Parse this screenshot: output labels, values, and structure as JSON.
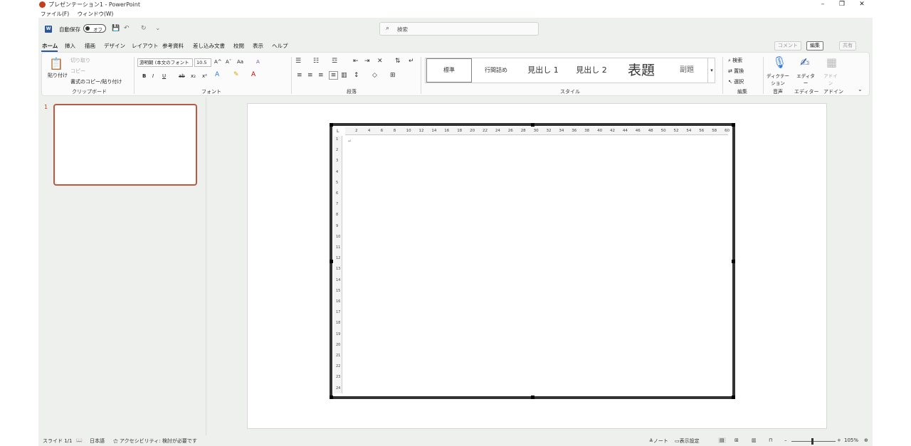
{
  "title_bar": {
    "title": "プレゼンテーション1 - PowerPoint",
    "minimize": "–",
    "restore": "❐",
    "close": "✕"
  },
  "menu_bar": [
    "ファイル(F)",
    "ウィンドウ(W)"
  ],
  "quick_access": {
    "app_letter": "W",
    "autosave_label": "自動保存",
    "autosave_state": "オフ",
    "save_icon": "💾",
    "undo_icon": "↶",
    "redo_icon": "↻",
    "more_icon": "⌄"
  },
  "search": {
    "icon": "⌕",
    "placeholder": "検索"
  },
  "tabs": [
    "ホーム",
    "挿入",
    "描画",
    "デザイン",
    "レイアウト",
    "参考資料",
    "差し込み文書",
    "校閲",
    "表示",
    "ヘルプ"
  ],
  "right_tabs": {
    "comments": "コメント",
    "editing": "編集",
    "share": "共有"
  },
  "ribbon": {
    "clipboard": {
      "paste": "貼り付け",
      "cut": "切り取り",
      "copy": "コピー",
      "format_painter": "書式のコピー/貼り付け",
      "label": "クリップボード"
    },
    "font": {
      "font_name": "游明朝 (本文のフォント",
      "font_size": "10.5",
      "grow": "A^",
      "shrink": "Aˇ",
      "case": "Aa",
      "clear": "A",
      "bold": "B",
      "italic": "I",
      "underline": "U",
      "strike": "ab",
      "sub": "x₂",
      "sup": "x²",
      "label": "フォント"
    },
    "paragraph": {
      "label": "段落"
    },
    "styles": {
      "items": [
        "標準",
        "行間詰め",
        "見出し 1",
        "見出し 2",
        "表題",
        "副題"
      ],
      "label": "スタイル"
    },
    "editing": {
      "find": "検索",
      "replace": "置換",
      "select": "選択",
      "label": "編集"
    },
    "voice": {
      "dictate": "ディクテーション",
      "label": "音声"
    },
    "editor": {
      "name": "エディター",
      "label": "エディター"
    },
    "addins": {
      "name": "アドイン",
      "label": "アドイン"
    }
  },
  "thumbnail": {
    "number": "1"
  },
  "ruler": {
    "h_ticks": [
      "2",
      "4",
      "6",
      "8",
      "10",
      "12",
      "14",
      "16",
      "18",
      "20",
      "22",
      "24",
      "26",
      "28",
      "30",
      "32",
      "34",
      "36",
      "38",
      "40",
      "42",
      "44",
      "46",
      "48",
      "50",
      "52",
      "54",
      "56",
      "58",
      "60"
    ],
    "v_ticks": [
      "1",
      "2",
      "3",
      "4",
      "5",
      "6",
      "7",
      "8",
      "9",
      "10",
      "11",
      "12",
      "13",
      "14",
      "15",
      "16",
      "17",
      "18",
      "19",
      "20",
      "21",
      "22",
      "23",
      "24"
    ],
    "corner": "L",
    "para_mark": "↵"
  },
  "status_bar": {
    "slide": "スライド 1/1",
    "language": "日本語",
    "accessibility": "アクセシビリティ: 検討が必要です",
    "notes": "ノート",
    "display_settings": "表示設定",
    "zoom": "105%"
  }
}
